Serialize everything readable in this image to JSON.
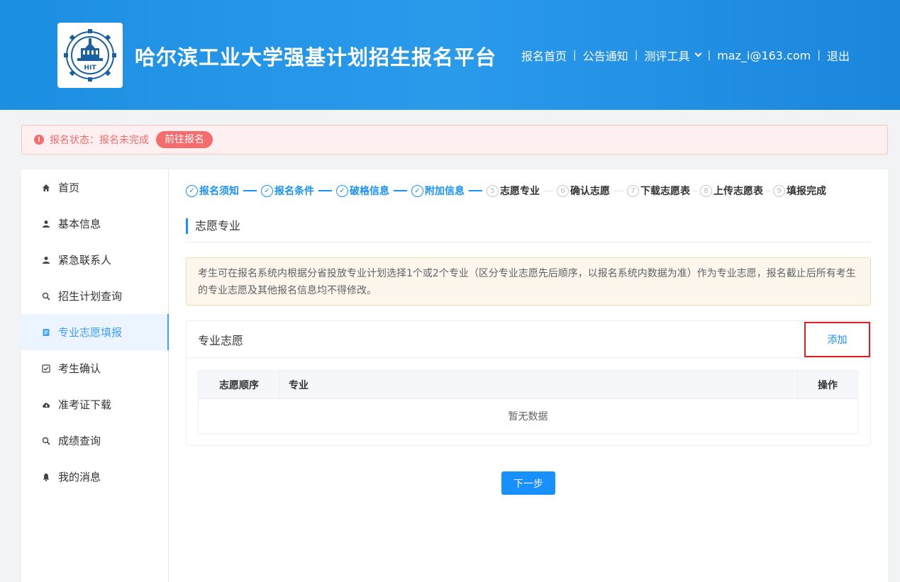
{
  "header": {
    "site_title": "哈尔滨工业大学强基计划招生报名平台",
    "logo_text": "HIT",
    "nav": [
      {
        "label": "报名首页"
      },
      {
        "label": "公告通知"
      },
      {
        "label": "测评工具"
      },
      {
        "label": "maz_i@163.com"
      },
      {
        "label": "退出"
      }
    ],
    "separator": "|"
  },
  "status_bar": {
    "icon": "!",
    "text": "报名状态：报名未完成",
    "button_label": "前往报名"
  },
  "sidebar": {
    "items": [
      {
        "label": "首页",
        "icon": "home-icon"
      },
      {
        "label": "基本信息",
        "icon": "user-icon"
      },
      {
        "label": "紧急联系人",
        "icon": "user-icon"
      },
      {
        "label": "招生计划查询",
        "icon": "search-icon"
      },
      {
        "label": "专业志愿填报",
        "icon": "document-icon",
        "active": true
      },
      {
        "label": "考生确认",
        "icon": "checkbox-icon"
      },
      {
        "label": "准考证下载",
        "icon": "cloud-icon"
      },
      {
        "label": "成绩查询",
        "icon": "search-icon"
      },
      {
        "label": "我的消息",
        "icon": "bell-icon"
      }
    ]
  },
  "steps": [
    {
      "label": "报名须知",
      "mark": "✓",
      "status": "done"
    },
    {
      "label": "报名条件",
      "mark": "✓",
      "status": "done"
    },
    {
      "label": "破格信息",
      "mark": "✓",
      "status": "done"
    },
    {
      "label": "附加信息",
      "mark": "✓",
      "status": "done"
    },
    {
      "label": "志愿专业",
      "mark": "5",
      "status": "todo"
    },
    {
      "label": "确认志愿",
      "mark": "6",
      "status": "todo"
    },
    {
      "label": "下载志愿表",
      "mark": "7",
      "status": "todo"
    },
    {
      "label": "上传志愿表",
      "mark": "8",
      "status": "todo"
    },
    {
      "label": "填报完成",
      "mark": "9",
      "status": "todo"
    }
  ],
  "main": {
    "section_title": "志愿专业",
    "notice": "考生可在报名系统内根据分省投放专业计划选择1个或2个专业（区分专业志愿先后顺序，以报名系统内数据为准）作为专业志愿，报名截止后所有考生的专业志愿及其他报名信息均不得修改。",
    "card_title": "专业志愿",
    "add_label": "添加",
    "table": {
      "columns": [
        "志愿顺序",
        "专业",
        "操作"
      ],
      "empty_text": "暂无数据"
    },
    "next_label": "下一步"
  },
  "colors": {
    "primary": "#1890ff",
    "header_bg": "#2a9aeb",
    "error": "#f56c6c",
    "highlight_border": "#e02020"
  }
}
